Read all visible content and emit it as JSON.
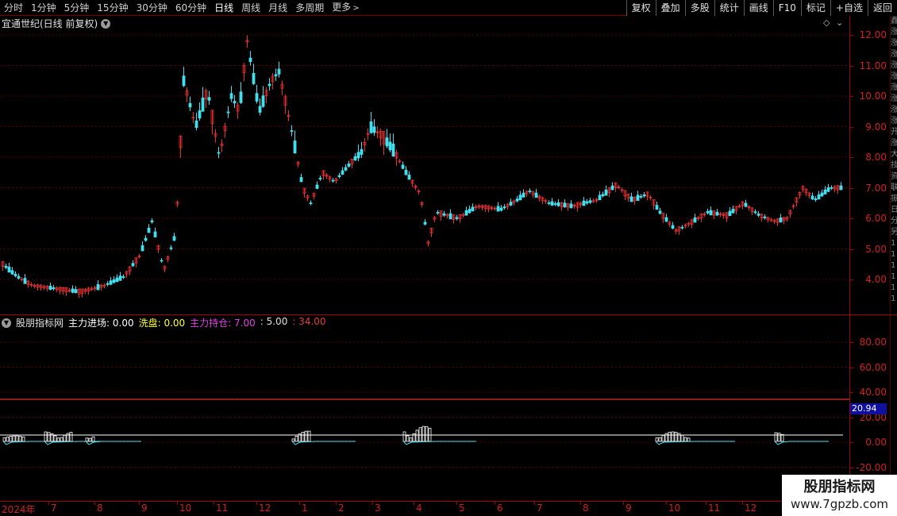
{
  "toolbar": {
    "periods": [
      "分时",
      "1分钟",
      "5分钟",
      "15分钟",
      "30分钟",
      "60分钟",
      "日线",
      "周线",
      "月线",
      "多周期"
    ],
    "active_period": "日线",
    "more_label": "更多",
    "right_buttons": [
      "复权",
      "叠加",
      "多股",
      "统计",
      "画线",
      "F10",
      "标记",
      "+自选",
      "返回"
    ]
  },
  "main_chart": {
    "title": "宜通世纪(日线 前复权)",
    "price_axis_labels": [
      "12.00",
      "11.00",
      "10.00",
      "9.00",
      "8.00",
      "7.00",
      "6.00",
      "5.00",
      "4.00"
    ],
    "up_color": "#e83030",
    "down_color": "#40e0f0"
  },
  "indicator": {
    "name": "股朋指标网",
    "items": [
      {
        "label": "主力进场: 0.00",
        "color": "#ffffff"
      },
      {
        "label": "洗盘: 0.00",
        "color": "#ffff30"
      },
      {
        "label": "主力持仓: 7.00",
        "color": "#e040e0"
      },
      {
        "label": ": 5.00",
        "color": "#e0e0e0"
      },
      {
        "label": ": 34.00",
        "color": "#e04040"
      }
    ],
    "axis_labels": [
      "80.00",
      "60.00",
      "40.00",
      "20.00",
      "0.00",
      "-20.00"
    ],
    "current_value": "20.94"
  },
  "time_axis": {
    "labels": [
      "2024年",
      "7",
      "8",
      "9",
      "10",
      "11",
      "12",
      "1",
      "2",
      "3",
      "4",
      "5",
      "6",
      "7",
      "8",
      "9",
      "10",
      "11",
      "12"
    ]
  },
  "right_strip": [
    "鑫",
    "涨",
    "涨",
    "涨",
    "涨",
    "涨",
    "涨",
    "涨",
    "涨",
    "涨",
    "开",
    "涨",
    "大",
    "技",
    "资",
    "联",
    "振",
    "日",
    "分",
    "另",
    "1",
    "1",
    "1",
    "1",
    "1",
    "1"
  ],
  "watermark": {
    "title": "股朋指标网",
    "url": "www.7gpzb.com"
  }
}
